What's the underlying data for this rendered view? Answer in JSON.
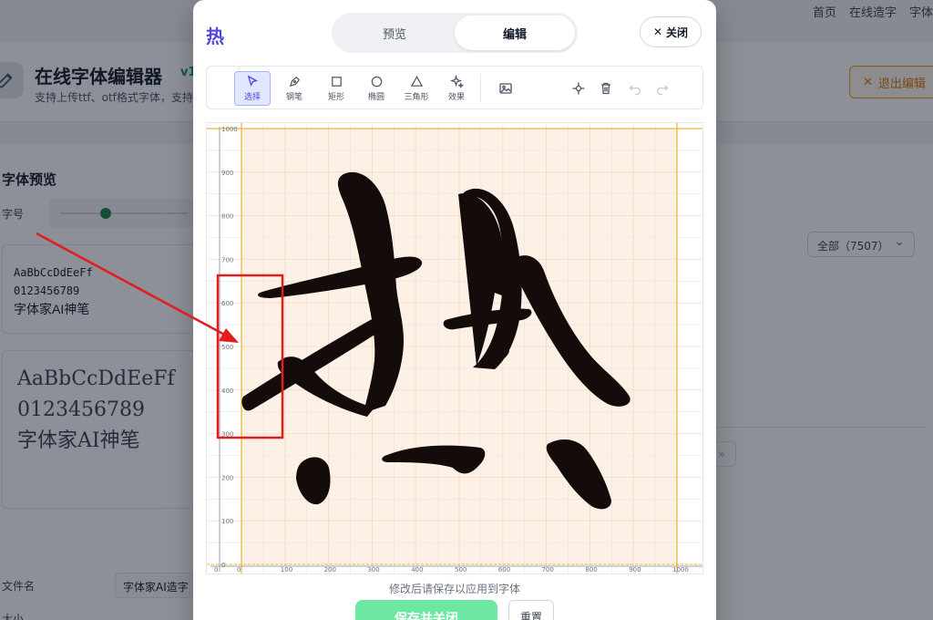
{
  "background": {
    "nav": [
      "首页",
      "在线造字",
      "字体"
    ],
    "app_title": "在线字体编辑器",
    "app_version": "v1",
    "app_subtitle": "支持上传ttf、otf格式字体，支持",
    "exit_label": "退出编辑",
    "section_title": "字体预览",
    "size_label": "字号",
    "preview_small": [
      "AaBbCcDdEeFf",
      "0123456789",
      "字体家AI神笔"
    ],
    "preview_large": [
      "AaBbCcDdEeFf",
      "0123456789",
      "字体家AI神笔"
    ],
    "filter_value": "全部（7507）",
    "pager_label": "»",
    "file_label": "文件名",
    "file_value": "字体家AI造字",
    "size2_label": "大小"
  },
  "modal": {
    "glyph_char": "热",
    "tabs": [
      {
        "label": "预览",
        "active": false
      },
      {
        "label": "编辑",
        "active": true
      }
    ],
    "close_label": "关闭",
    "tools": [
      {
        "label": "选择",
        "icon": "cursor-icon",
        "active": true
      },
      {
        "label": "钢笔",
        "icon": "pen-icon",
        "active": false
      },
      {
        "label": "矩形",
        "icon": "rectangle-icon",
        "active": false
      },
      {
        "label": "椭圆",
        "icon": "ellipse-icon",
        "active": false
      },
      {
        "label": "三角形",
        "icon": "triangle-icon",
        "active": false
      },
      {
        "label": "效果",
        "icon": "sparkle-icon",
        "active": false
      }
    ],
    "actions": [
      "image-icon",
      "crosshair-icon",
      "trash-icon",
      "undo-icon",
      "redo-icon"
    ],
    "y_ticks": [
      "1000",
      "900",
      "800",
      "700",
      "600",
      "500",
      "400",
      "300",
      "200",
      "100",
      "0"
    ],
    "x_ticks": [
      "0",
      "100",
      "200",
      "300",
      "400",
      "500",
      "600",
      "700",
      "800",
      "900",
      "1000"
    ],
    "corner_tick": "0",
    "hint": "修改后请保存以应用到字体",
    "save_label": "保存并关闭",
    "reset_label": "重置"
  },
  "colors": {
    "accent": "#4f46e5",
    "save_green": "#6ee7a2",
    "annotation_red": "#e11d1d",
    "guide_orange": "#f59e0b",
    "glyph_fill": "#140c0a"
  }
}
